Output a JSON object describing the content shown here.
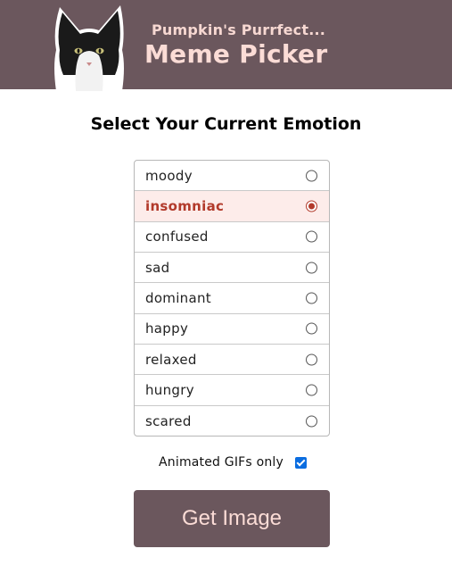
{
  "header": {
    "subtitle": "Pumpkin's Purrfect...",
    "title": "Meme Picker"
  },
  "heading": "Select Your Current Emotion",
  "emotions": [
    {
      "label": "moody",
      "selected": false
    },
    {
      "label": "insomniac",
      "selected": true
    },
    {
      "label": "confused",
      "selected": false
    },
    {
      "label": "sad",
      "selected": false
    },
    {
      "label": "dominant",
      "selected": false
    },
    {
      "label": "happy",
      "selected": false
    },
    {
      "label": "relaxed",
      "selected": false
    },
    {
      "label": "hungry",
      "selected": false
    },
    {
      "label": "scared",
      "selected": false
    }
  ],
  "gif_option": {
    "label": "Animated GIFs only",
    "checked": true
  },
  "button": {
    "label": "Get Image"
  },
  "colors": {
    "header_bg": "#6b575d",
    "header_text": "#fbdcd6",
    "selected_bg": "#fdecea",
    "selected_text": "#b23a2b",
    "checkbox": "#0b6de0"
  }
}
